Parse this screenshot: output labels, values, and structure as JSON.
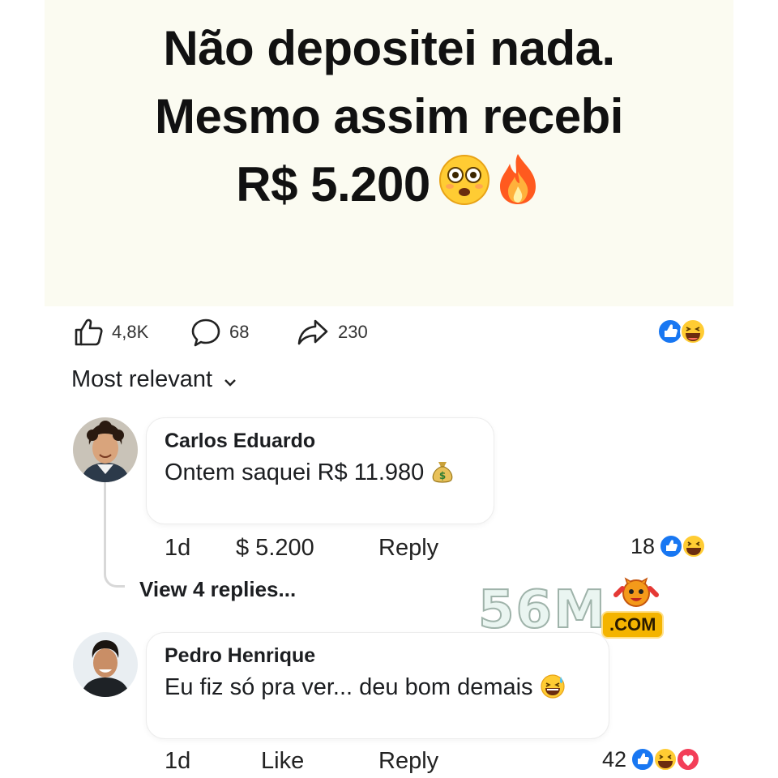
{
  "post": {
    "headline_lines": [
      "Não depositei nada.",
      "Mesmo assim recebi",
      "R$ 5.200"
    ],
    "headline_emojis": [
      "flushed-face-emoji",
      "fire-emoji"
    ]
  },
  "actions": {
    "likes": "4,8K",
    "comments": "68",
    "shares": "230",
    "reaction_icons": [
      "like-reaction-icon",
      "haha-reaction-icon"
    ]
  },
  "sort": {
    "label": "Most relevant"
  },
  "comments": [
    {
      "author": "Carlos Eduardo",
      "text": "Ontem saquei R$ 11.980",
      "emoji": "money-bag-emoji",
      "time": "1d",
      "second_action": "$ 5.200",
      "reply_label": "Reply",
      "reaction_count": "18",
      "reaction_icons": [
        "like-reaction-icon",
        "haha-reaction-icon"
      ],
      "view_replies": "View 4 replies..."
    },
    {
      "author": "Pedro Henrique",
      "text": "Eu fiz só pra ver... deu bom demais",
      "emoji": "grinning-sweat-emoji",
      "time": "1d",
      "second_action": "Like",
      "reply_label": "Reply",
      "reaction_count": "42",
      "reaction_icons": [
        "like-reaction-icon",
        "haha-reaction-icon",
        "love-reaction-icon"
      ]
    }
  ],
  "watermark": {
    "number": "56M",
    "suffix": ".COM"
  }
}
